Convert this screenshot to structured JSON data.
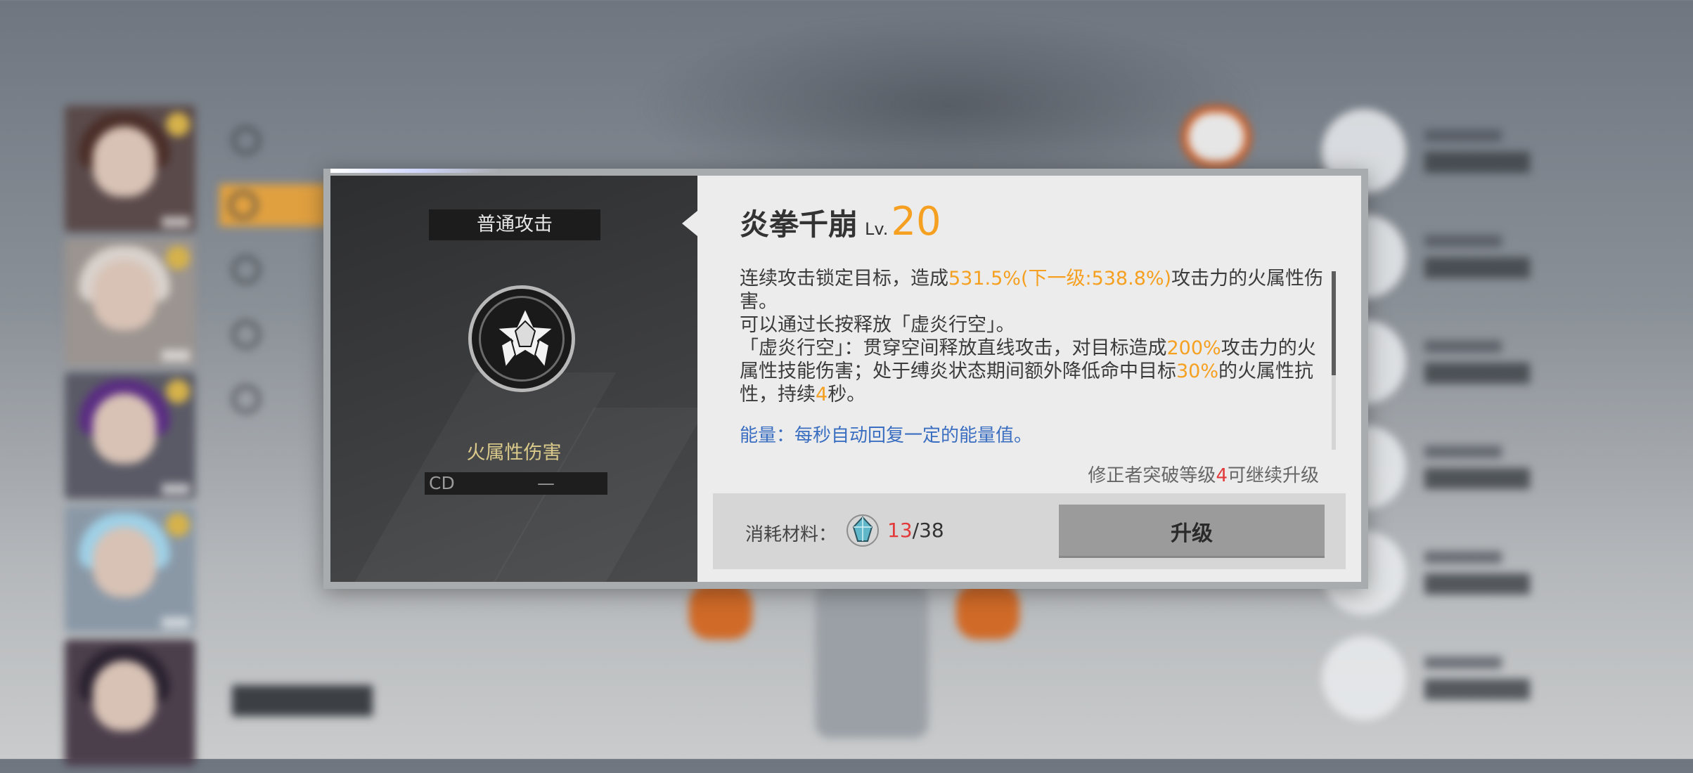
{
  "skill": {
    "category": "普通攻击",
    "name": "炎拳千崩",
    "level_prefix": "Lv.",
    "level": "20",
    "element": "火属性伤害",
    "cd_label": "CD",
    "cd_value": "—"
  },
  "description": {
    "p1": [
      "连续攻击锁定目标，造成",
      "531.5%(下一级:538.8%)",
      "攻击力的火属性伤害。"
    ],
    "p2": "可以通过长按释放「虚炎行空」。",
    "p3": [
      "「虚炎行空」：贯穿空间释放直线攻击，对目标造成",
      "200%",
      "攻击力的火属性技能伤害；处于缚炎状态期间额外降低命中目标",
      "30%",
      "的火属性抗性，持续",
      "4",
      "秒。"
    ],
    "energy": "能量：每秒自动回复一定的能量值。"
  },
  "requirement": {
    "prefix": "修正者突破等级",
    "level": "4",
    "suffix": "可继续升级"
  },
  "cost": {
    "label": "消耗材料：",
    "have": "13",
    "separator": "/",
    "need": "38"
  },
  "buttons": {
    "upgrade": "升级"
  },
  "colors": {
    "highlight": "#f5a020",
    "warning": "#e23a3a",
    "energy_text": "#3a6ec0",
    "element_text": "#d9c98a"
  }
}
